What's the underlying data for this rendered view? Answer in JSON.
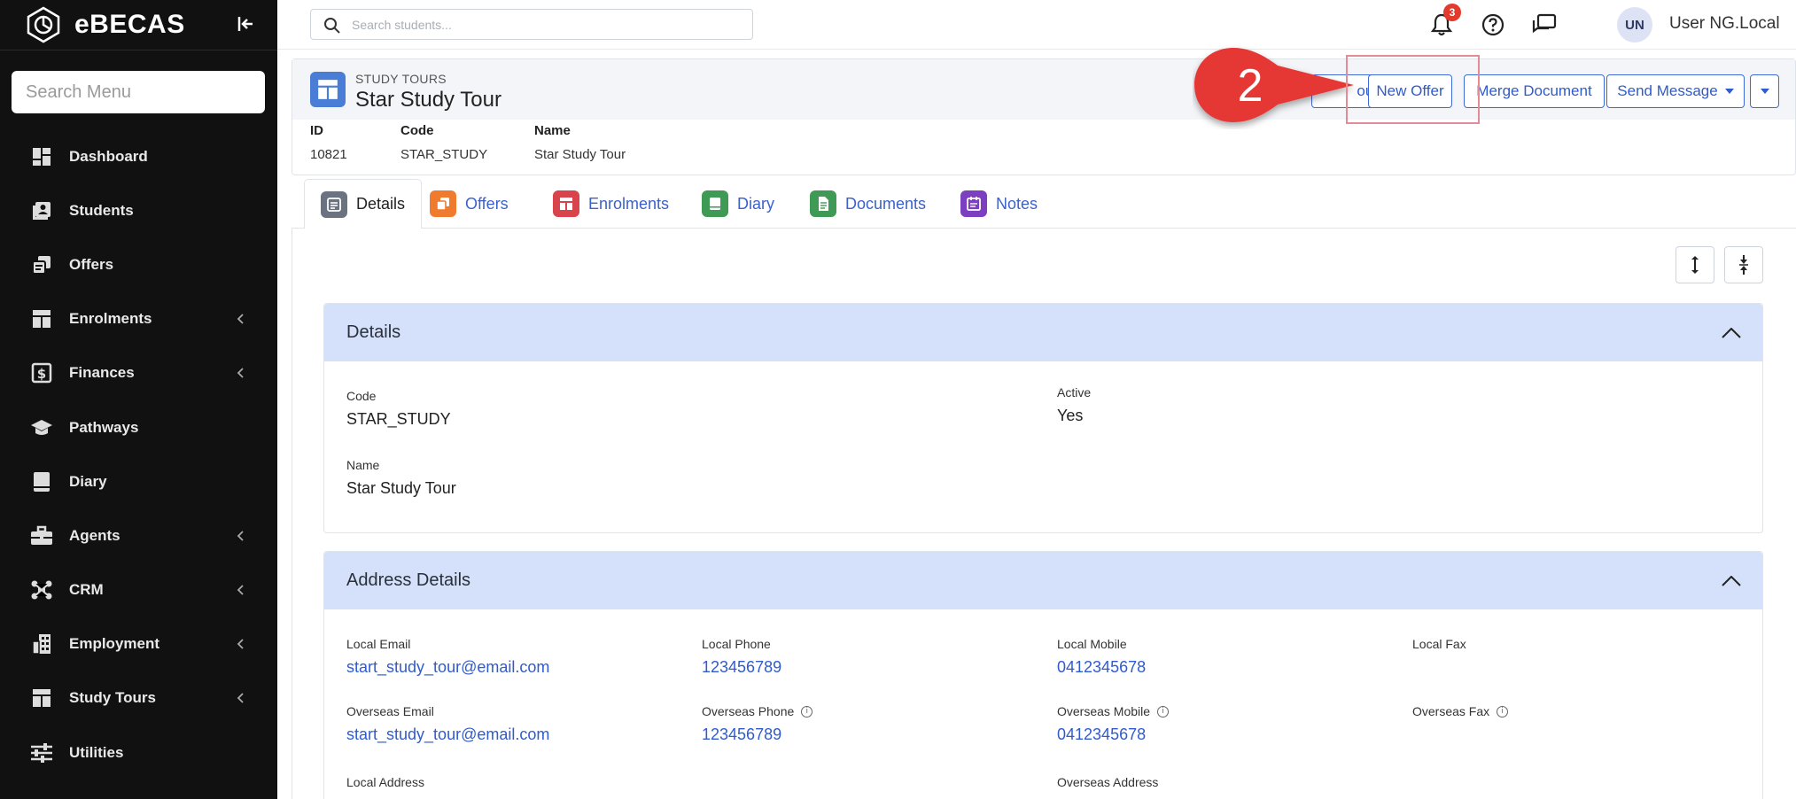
{
  "app": {
    "name": "eBECAS"
  },
  "sidebar": {
    "search_placeholder": "Search Menu",
    "items": [
      {
        "label": "Dashboard",
        "icon": "dashboard-icon",
        "has_submenu": false
      },
      {
        "label": "Students",
        "icon": "students-icon",
        "has_submenu": false
      },
      {
        "label": "Offers",
        "icon": "offers-icon",
        "has_submenu": false
      },
      {
        "label": "Enrolments",
        "icon": "enrolments-icon",
        "has_submenu": true
      },
      {
        "label": "Finances",
        "icon": "finances-icon",
        "has_submenu": true
      },
      {
        "label": "Pathways",
        "icon": "pathways-icon",
        "has_submenu": false
      },
      {
        "label": "Diary",
        "icon": "diary-icon",
        "has_submenu": false
      },
      {
        "label": "Agents",
        "icon": "agents-icon",
        "has_submenu": true
      },
      {
        "label": "CRM",
        "icon": "crm-icon",
        "has_submenu": true
      },
      {
        "label": "Employment",
        "icon": "employment-icon",
        "has_submenu": true
      },
      {
        "label": "Study Tours",
        "icon": "study-tours-icon",
        "has_submenu": true
      },
      {
        "label": "Utilities",
        "icon": "utilities-icon",
        "has_submenu": false
      }
    ]
  },
  "topbar": {
    "search_placeholder": "Search students...",
    "notification_count": "3",
    "user_initials": "UN",
    "user_name": "User NG.Local"
  },
  "record": {
    "breadcrumb": "STUDY TOURS",
    "title": "Star Study Tour",
    "actions": {
      "partial_label": "our",
      "new_offer": "New Offer",
      "merge_document": "Merge Document",
      "send_message": "Send Message"
    },
    "callout_number": "2",
    "fields": [
      {
        "label": "ID",
        "value": "10821"
      },
      {
        "label": "Code",
        "value": "STAR_STUDY"
      },
      {
        "label": "Name",
        "value": "Star Study Tour"
      }
    ]
  },
  "tabs": [
    {
      "label": "Details",
      "icon": "details-tab-icon",
      "color": "#6b7280",
      "active": true
    },
    {
      "label": "Offers",
      "icon": "offers-tab-icon",
      "color": "#f07a2e",
      "active": false
    },
    {
      "label": "Enrolments",
      "icon": "enrolments-tab-icon",
      "color": "#d9434b",
      "active": false
    },
    {
      "label": "Diary",
      "icon": "diary-tab-icon",
      "color": "#3f9a55",
      "active": false
    },
    {
      "label": "Documents",
      "icon": "documents-tab-icon",
      "color": "#3f9a55",
      "active": false
    },
    {
      "label": "Notes",
      "icon": "notes-tab-icon",
      "color": "#7b3fc0",
      "active": false
    }
  ],
  "details_panel": {
    "title": "Details",
    "code_label": "Code",
    "code_value": "STAR_STUDY",
    "active_label": "Active",
    "active_value": "Yes",
    "name_label": "Name",
    "name_value": "Star Study Tour"
  },
  "address_panel": {
    "title": "Address Details",
    "local_email_label": "Local Email",
    "local_email": "start_study_tour@email.com",
    "local_phone_label": "Local Phone",
    "local_phone": "123456789",
    "local_mobile_label": "Local Mobile",
    "local_mobile": "0412345678",
    "local_fax_label": "Local Fax",
    "overseas_email_label": "Overseas Email",
    "overseas_email": "start_study_tour@email.com",
    "overseas_phone_label": "Overseas Phone",
    "overseas_phone": "123456789",
    "overseas_mobile_label": "Overseas Mobile",
    "overseas_mobile": "0412345678",
    "overseas_fax_label": "Overseas Fax",
    "local_address_label": "Local Address",
    "overseas_address_label": "Overseas Address"
  },
  "colors": {
    "sidebar_bg": "#111111",
    "accent_blue": "#2f5bcf",
    "panel_header_bg": "#d5e1fa",
    "callout_red": "#e53935",
    "highlight_border": "#e48b97",
    "badge_red": "#e23a2c"
  }
}
